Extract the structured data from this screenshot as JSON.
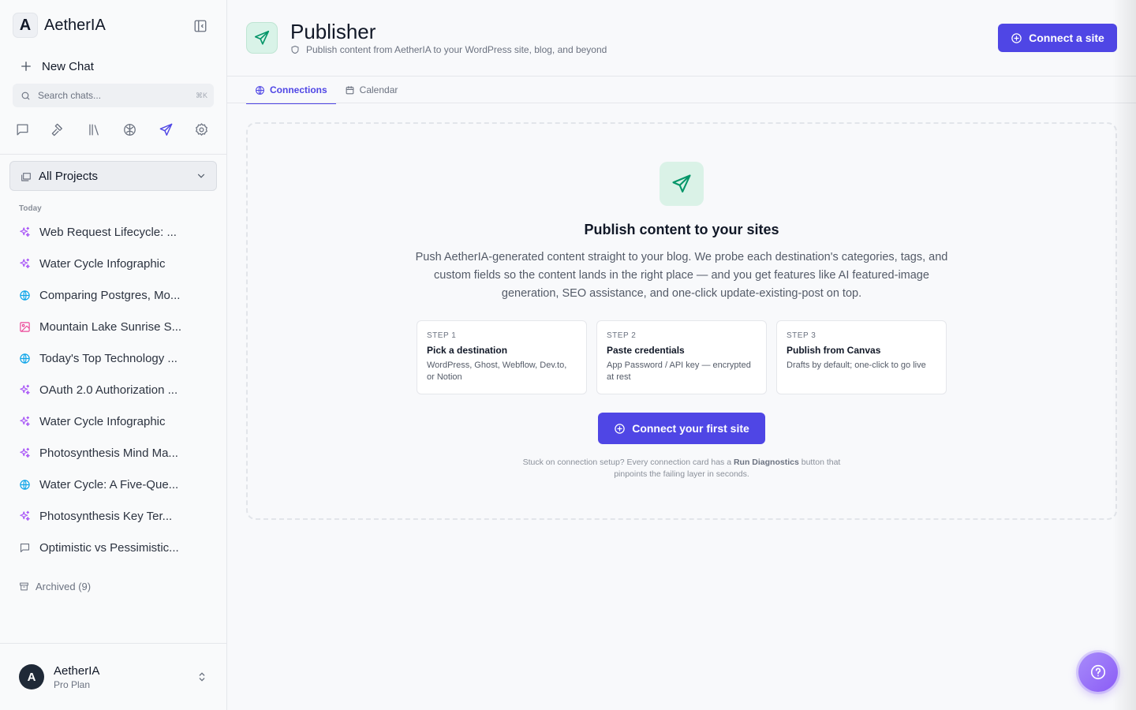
{
  "app": {
    "brand_letter": "A",
    "brand_name": "AetherIA"
  },
  "sidebar": {
    "new_chat_label": "New Chat",
    "search_placeholder": "Search chats...",
    "search_shortcut": "⌘K",
    "tools": [
      "chat-icon",
      "hammer-icon",
      "library-icon",
      "brain-icon",
      "send-icon",
      "gear-icon"
    ],
    "active_tool": "send-icon",
    "projects_label": "All Projects",
    "section_today": "Today",
    "chats": [
      {
        "title": "Web Request Lifecycle: ...",
        "icon": "sparkles-icon"
      },
      {
        "title": "Water Cycle Infographic",
        "icon": "sparkles-icon"
      },
      {
        "title": "Comparing Postgres, Mo...",
        "icon": "globe-icon"
      },
      {
        "title": "Mountain Lake Sunrise S...",
        "icon": "image-icon"
      },
      {
        "title": "Today's Top Technology ...",
        "icon": "globe-icon"
      },
      {
        "title": "OAuth 2.0 Authorization ...",
        "icon": "sparkles-icon"
      },
      {
        "title": "Water Cycle Infographic",
        "icon": "sparkles-icon"
      },
      {
        "title": "Photosynthesis Mind Ma...",
        "icon": "sparkles-icon"
      },
      {
        "title": "Water Cycle: A Five-Que...",
        "icon": "globe-icon"
      },
      {
        "title": "Photosynthesis Key Ter...",
        "icon": "sparkles-icon"
      },
      {
        "title": "Optimistic vs Pessimistic...",
        "icon": "chat-icon"
      }
    ],
    "archived_label": "Archived (9)",
    "user": {
      "avatar_letter": "A",
      "name": "AetherIA",
      "plan": "Pro Plan"
    }
  },
  "header": {
    "title": "Publisher",
    "subtitle": "Publish content from AetherIA to your WordPress site, blog, and beyond",
    "connect_button": "Connect a site"
  },
  "tabs": [
    {
      "label": "Connections",
      "icon": "globe-icon",
      "active": true
    },
    {
      "label": "Calendar",
      "icon": "calendar-icon",
      "active": false
    }
  ],
  "empty_state": {
    "title": "Publish content to your sites",
    "description": "Push AetherIA-generated content straight to your blog. We probe each destination's categories, tags, and custom fields so the content lands in the right place — and you get features like AI featured-image generation, SEO assistance, and one-click update-existing-post on top.",
    "steps": [
      {
        "step": "STEP 1",
        "title": "Pick a destination",
        "desc": "WordPress, Ghost, Webflow, Dev.to, or Notion"
      },
      {
        "step": "STEP 2",
        "title": "Paste credentials",
        "desc": "App Password / API key — encrypted at rest"
      },
      {
        "step": "STEP 3",
        "title": "Publish from Canvas",
        "desc": "Drafts by default; one-click to go live"
      }
    ],
    "cta_label": "Connect your first site",
    "help_prefix": "Stuck on connection setup? Every connection card has a ",
    "help_bold": "Run Diagnostics",
    "help_suffix": " button that pinpoints the failing layer in seconds."
  },
  "colors": {
    "accent": "#4f46e5",
    "publisher_green": "#059669",
    "sparkles": "#a855f7",
    "globe": "#0ea5e9",
    "image": "#ec4899"
  }
}
